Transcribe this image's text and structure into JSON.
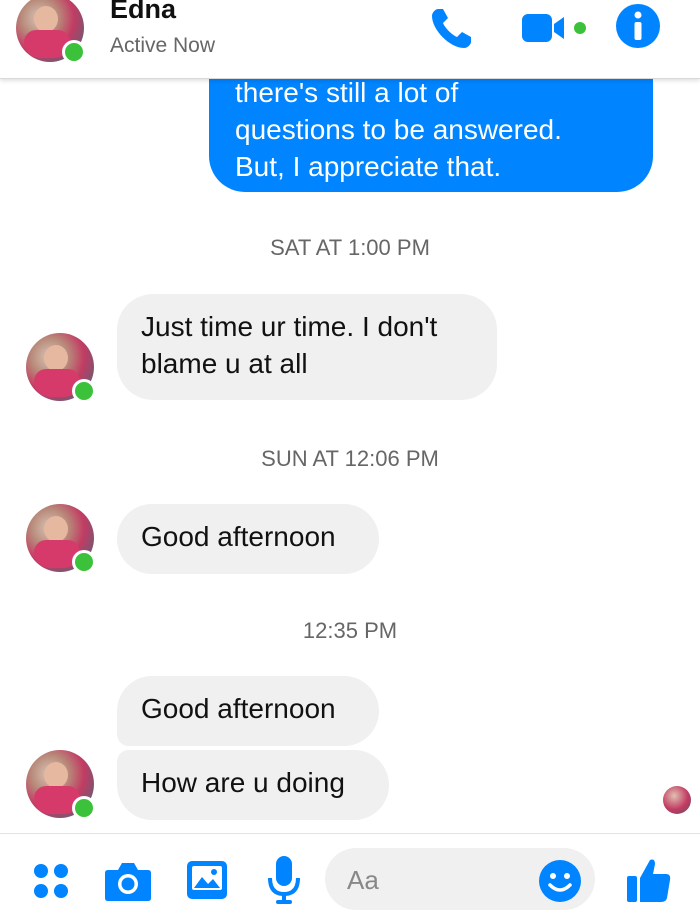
{
  "header": {
    "contact_name": "Edna",
    "status": "Active Now",
    "icons": [
      "phone-icon",
      "video-camera-icon",
      "info-icon"
    ]
  },
  "messages": [
    {
      "sender": "me",
      "lines": [
        "there's still a lot of",
        "questions to be answered.",
        "But, I appreciate that."
      ]
    },
    {
      "type": "timestamp",
      "text": "SAT AT 1:00 PM"
    },
    {
      "sender": "Edna",
      "lines": [
        "Just time ur time. I don't",
        "blame u at all"
      ]
    },
    {
      "type": "timestamp",
      "text": "SUN AT 12:06 PM"
    },
    {
      "sender": "Edna",
      "lines": [
        "Good afternoon"
      ]
    },
    {
      "type": "timestamp",
      "text": "12:35 PM"
    },
    {
      "sender": "Edna",
      "lines": [
        "Good afternoon"
      ]
    },
    {
      "sender": "Edna",
      "lines": [
        "How are u doing"
      ]
    }
  ],
  "composer": {
    "placeholder": "Aa",
    "icons": [
      "more-apps-icon",
      "camera-icon",
      "gallery-icon",
      "microphone-icon",
      "emoji-icon",
      "thumbs-up-icon"
    ]
  },
  "colors": {
    "accent": "#0084ff",
    "online": "#3cc13b",
    "incoming_bubble": "#f0f0f0"
  }
}
